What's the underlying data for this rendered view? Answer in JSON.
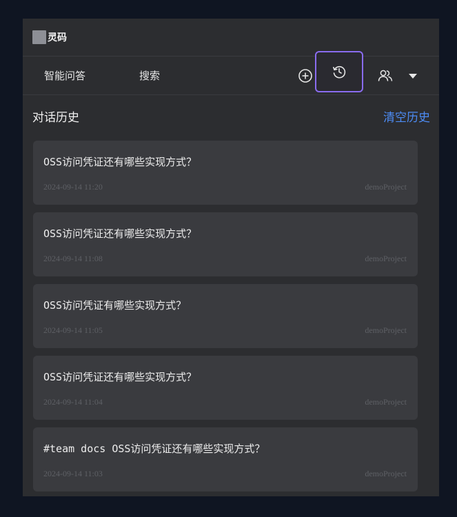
{
  "app": {
    "title": "灵码",
    "logo_icon": "logo-placeholder"
  },
  "toolbar": {
    "tabs": [
      {
        "label": "智能问答"
      },
      {
        "label": "搜索"
      }
    ],
    "icons": [
      "add-circle-icon",
      "history-icon",
      "users-icon",
      "chevron-down-icon"
    ],
    "highlight_color": "#8a6cf0"
  },
  "history": {
    "title": "对话历史",
    "clear_label": "清空历史",
    "items": [
      {
        "question": "OSS访问凭证还有哪些实现方式？",
        "time": "2024-09-14 11:20",
        "project": "demoProject"
      },
      {
        "question": "OSS访问凭证还有哪些实现方式？",
        "time": "2024-09-14 11:08",
        "project": "demoProject"
      },
      {
        "question": "OSS访问凭证有哪些实现方式？",
        "time": "2024-09-14 11:05",
        "project": "demoProject"
      },
      {
        "question": "OSS访问凭证还有哪些实现方式？",
        "time": "2024-09-14 11:04",
        "project": "demoProject"
      },
      {
        "question": "#team docs OSS访问凭证还有哪些实现方式？",
        "time": "2024-09-14 11:03",
        "project": "demoProject"
      }
    ]
  },
  "colors": {
    "accent_link": "#4d8cf5",
    "panel_bg": "#2c2d30",
    "card_bg": "#3a3b3f"
  }
}
